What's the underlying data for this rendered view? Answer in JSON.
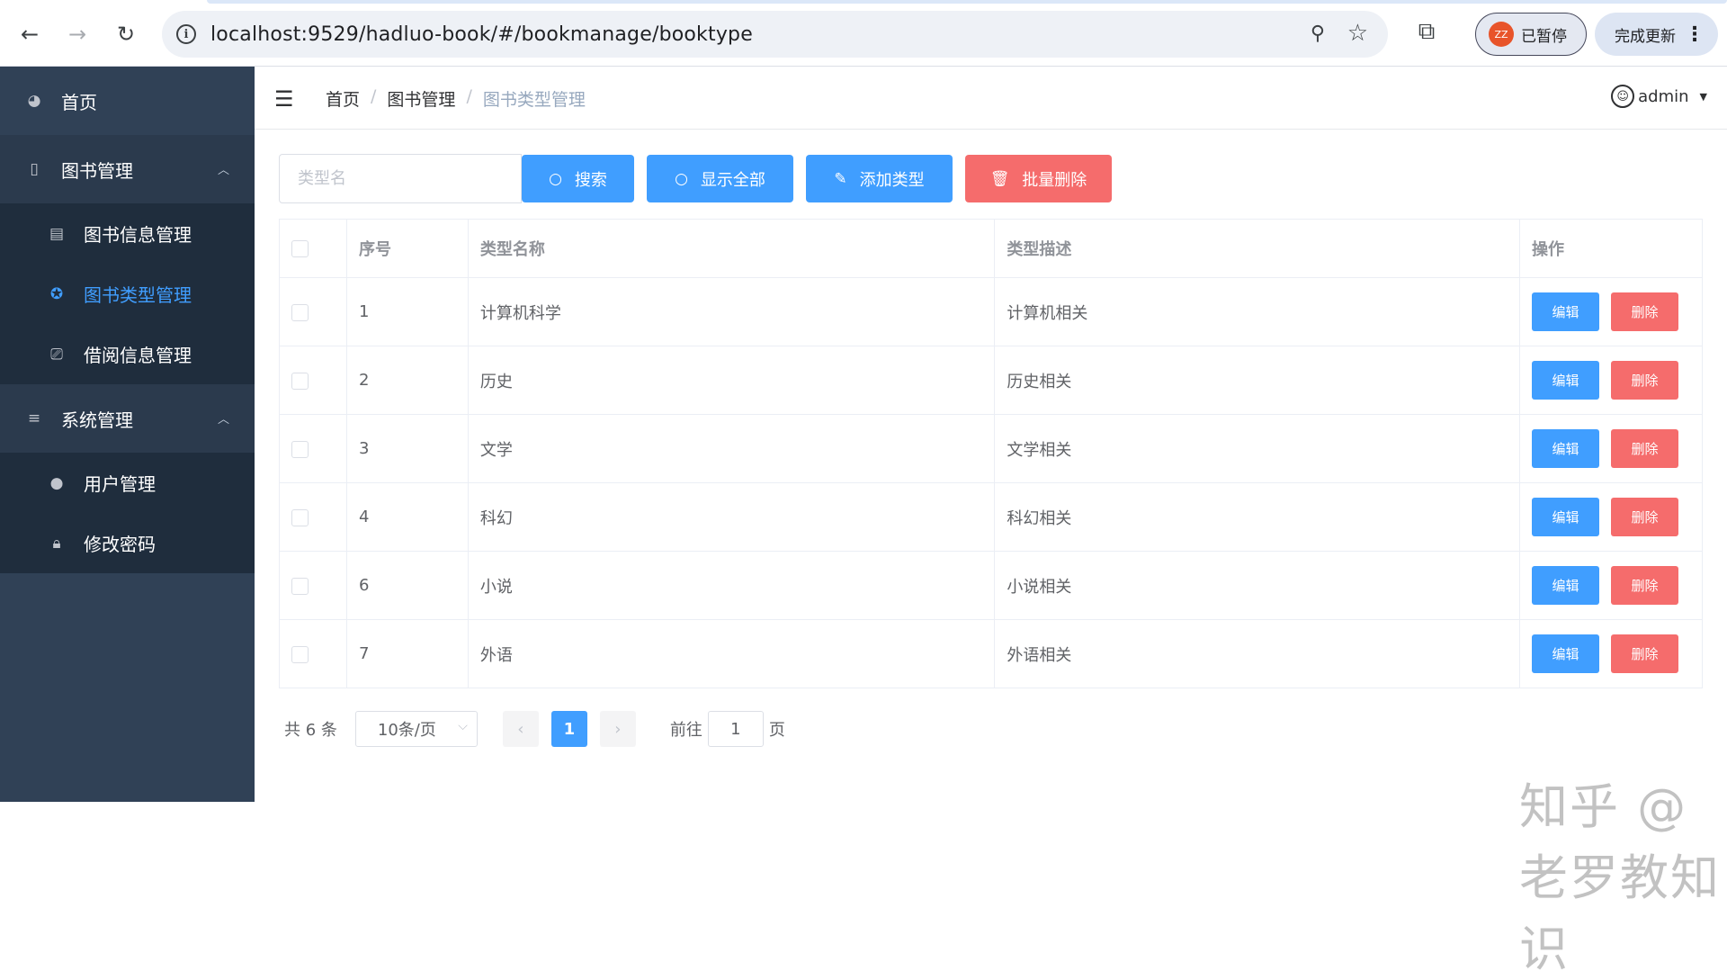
{
  "browser": {
    "url": "localhost:9529/hadluo-book/#/bookmanage/booktype",
    "profile_initials": "ZZ",
    "profile_label": "已暂停",
    "update_label": "完成更新"
  },
  "sidebar": {
    "items": [
      {
        "label": "首页",
        "icon": "dashboard-icon"
      },
      {
        "label": "图书管理",
        "icon": "book-icon"
      },
      {
        "label": "图书信息管理",
        "icon": "document-icon"
      },
      {
        "label": "图书类型管理",
        "icon": "type-icon"
      },
      {
        "label": "借阅信息管理",
        "icon": "borrow-icon"
      },
      {
        "label": "系统管理",
        "icon": "list-icon"
      },
      {
        "label": "用户管理",
        "icon": "user-icon"
      },
      {
        "label": "修改密码",
        "icon": "lock-icon"
      }
    ]
  },
  "navbar": {
    "breadcrumb": [
      "首页",
      "图书管理",
      "图书类型管理"
    ],
    "username": "admin"
  },
  "toolbar": {
    "search_placeholder": "类型名",
    "search_label": "搜索",
    "show_all_label": "显示全部",
    "add_label": "添加类型",
    "batch_delete_label": "批量删除"
  },
  "table": {
    "headers": [
      "序号",
      "类型名称",
      "类型描述",
      "操作"
    ],
    "rows": [
      {
        "no": "1",
        "name": "计算机科学",
        "desc": "计算机相关"
      },
      {
        "no": "2",
        "name": "历史",
        "desc": "历史相关"
      },
      {
        "no": "3",
        "name": "文学",
        "desc": "文学相关"
      },
      {
        "no": "4",
        "name": "科幻",
        "desc": "科幻相关"
      },
      {
        "no": "6",
        "name": "小说",
        "desc": "小说相关"
      },
      {
        "no": "7",
        "name": "外语",
        "desc": "外语相关"
      }
    ],
    "edit_label": "编辑",
    "delete_label": "删除"
  },
  "pagination": {
    "total": "共 6 条",
    "page_size": "10条/页",
    "current_page": "1",
    "goto_prefix": "前往",
    "goto_value": "1",
    "goto_suffix": "页"
  },
  "watermark": "知乎 @老罗教知识",
  "colors": {
    "primary": "#409eff",
    "danger": "#f56c6c",
    "sidebar": "#304156",
    "sidebar_sub": "#1f2d3d"
  }
}
